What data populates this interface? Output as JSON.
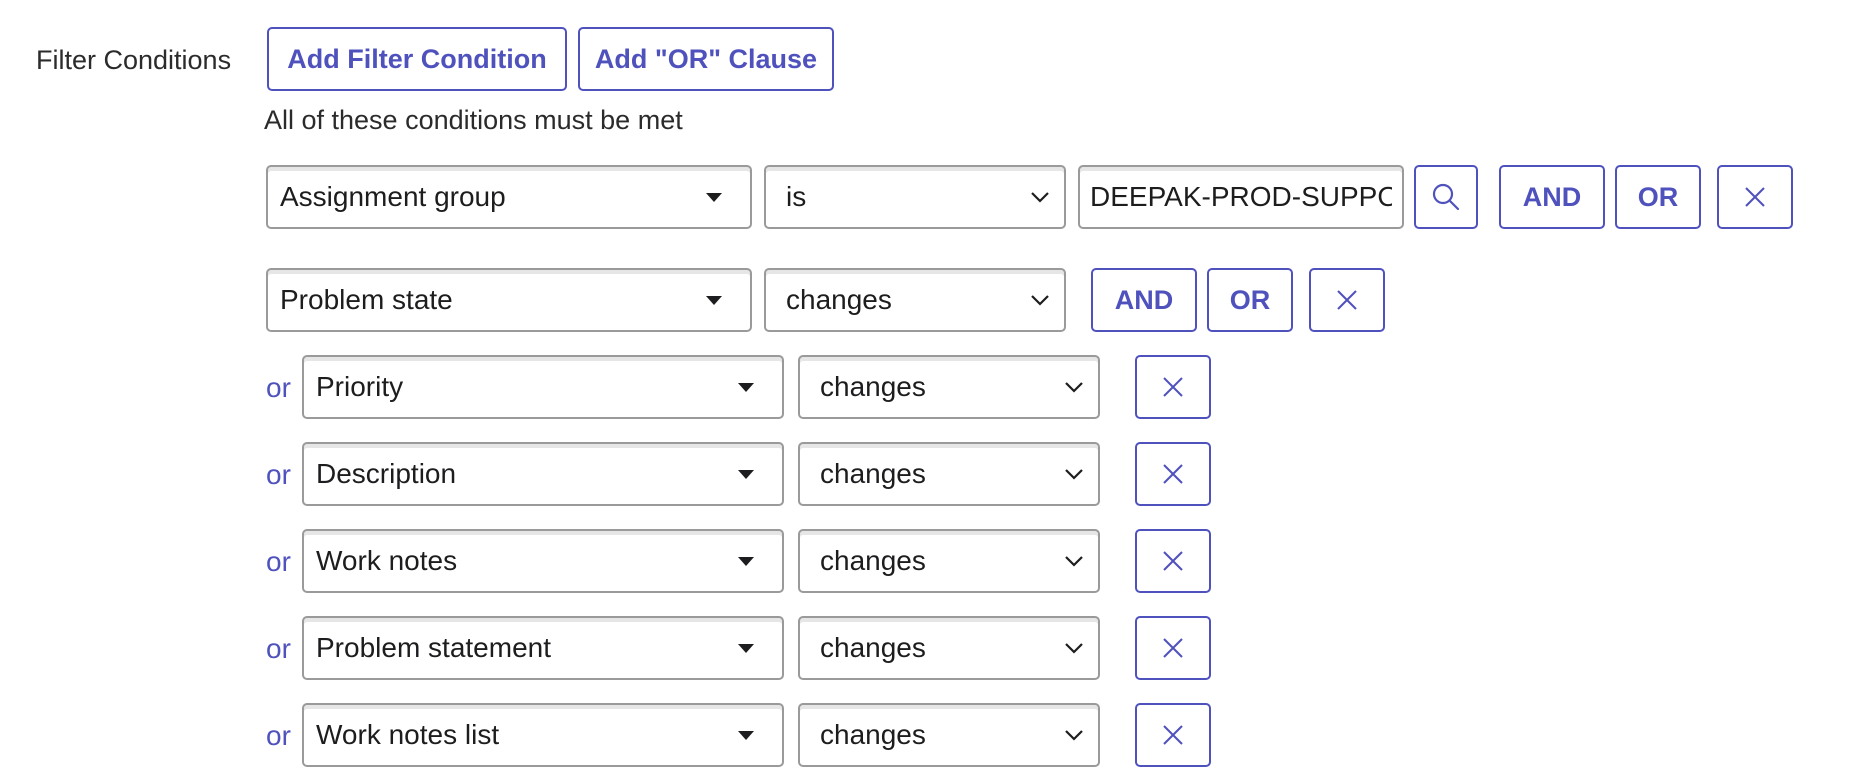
{
  "header": {
    "label": "Filter Conditions",
    "add_filter_label": "Add Filter Condition",
    "add_or_label": "Add \"OR\" Clause"
  },
  "conditions_note": "All of these conditions must be met",
  "rows": [
    {
      "field": "Assignment group",
      "operator": "is",
      "value": "DEEPAK-PROD-SUPPORT",
      "and_label": "AND",
      "or_label": "OR"
    },
    {
      "field": "Problem state",
      "operator": "changes",
      "and_label": "AND",
      "or_label": "OR"
    }
  ],
  "or_rows": [
    {
      "prefix": "or",
      "field": "Priority",
      "operator": "changes"
    },
    {
      "prefix": "or",
      "field": "Description",
      "operator": "changes"
    },
    {
      "prefix": "or",
      "field": "Work notes",
      "operator": "changes"
    },
    {
      "prefix": "or",
      "field": "Problem statement",
      "operator": "changes"
    },
    {
      "prefix": "or",
      "field": "Work notes list",
      "operator": "changes"
    }
  ],
  "icons": {
    "search": "search-icon",
    "remove": "close-icon",
    "dropdown": "caret-down-icon",
    "select": "chevron-down-icon"
  },
  "colors": {
    "accent": "#4f52bd",
    "border": "#9a9a9a",
    "text": "#1d1d1f"
  }
}
